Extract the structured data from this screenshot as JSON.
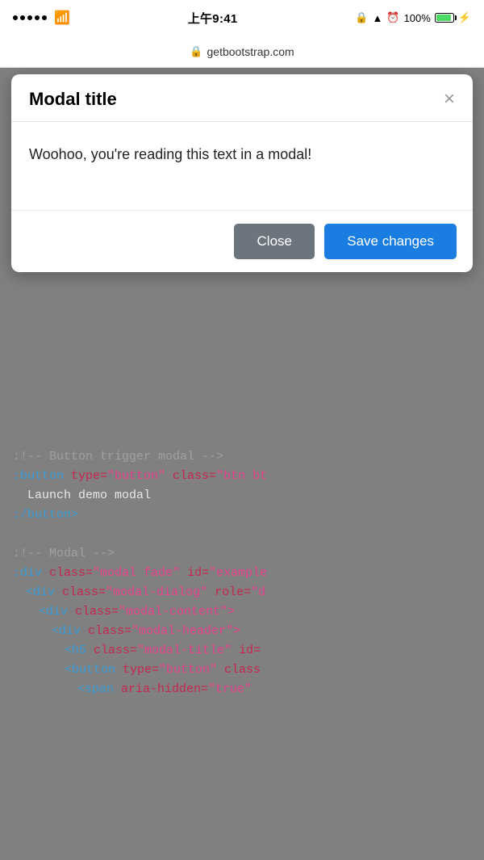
{
  "statusBar": {
    "time": "上午9:41",
    "carrier": "signal",
    "wifi": true,
    "battery": "100%",
    "url": "getbootstrap.com"
  },
  "modal": {
    "title": "Modal title",
    "body": "Woohoo, you're reading this text in a modal!",
    "closeButton": "Close",
    "saveButton": "Save changes",
    "closeIcon": "×"
  },
  "code": {
    "lines": [
      {
        "type": "comment",
        "text": ":!-- Button trigger modal -->"
      },
      {
        "type": "mixed",
        "parts": [
          {
            "t": "tag",
            "v": ":button "
          },
          {
            "t": "attr",
            "v": "type="
          },
          {
            "t": "string",
            "v": "\"button\" "
          },
          {
            "t": "attr",
            "v": "class="
          },
          {
            "t": "string",
            "v": "\"btn bt"
          }
        ]
      },
      {
        "type": "text",
        "text": "  Launch demo modal"
      },
      {
        "type": "tag",
        "text": ":/button>"
      },
      {
        "type": "blank"
      },
      {
        "type": "comment",
        "text": ":!-- Modal -->"
      },
      {
        "type": "mixed",
        "parts": [
          {
            "t": "tag",
            "v": ":div "
          },
          {
            "t": "attr",
            "v": "class="
          },
          {
            "t": "string",
            "v": "\"modal fade\" "
          },
          {
            "t": "attr",
            "v": "id="
          },
          {
            "t": "string",
            "v": "\"example"
          }
        ]
      },
      {
        "type": "mixed",
        "indent": 1,
        "parts": [
          {
            "t": "tag",
            "v": "<div "
          },
          {
            "t": "attr",
            "v": "class="
          },
          {
            "t": "string",
            "v": "\"modal-dialog\" "
          },
          {
            "t": "attr",
            "v": "role="
          },
          {
            "t": "string",
            "v": "\"d"
          }
        ]
      },
      {
        "type": "mixed",
        "indent": 2,
        "parts": [
          {
            "t": "tag",
            "v": "<div "
          },
          {
            "t": "attr",
            "v": "class="
          },
          {
            "t": "string",
            "v": "\"modal-content\">"
          }
        ]
      },
      {
        "type": "mixed",
        "indent": 3,
        "parts": [
          {
            "t": "tag",
            "v": "<div "
          },
          {
            "t": "attr",
            "v": "class="
          },
          {
            "t": "string",
            "v": "\"modal-header\">"
          }
        ]
      },
      {
        "type": "mixed",
        "indent": 4,
        "parts": [
          {
            "t": "tag",
            "v": "<h5 "
          },
          {
            "t": "attr",
            "v": "class="
          },
          {
            "t": "string",
            "v": "\"modal-title\" "
          },
          {
            "t": "attr",
            "v": "id="
          }
        ]
      },
      {
        "type": "mixed",
        "indent": 4,
        "parts": [
          {
            "t": "tag",
            "v": "<button "
          },
          {
            "t": "attr",
            "v": "type="
          },
          {
            "t": "string",
            "v": "\"button\" "
          },
          {
            "t": "attr",
            "v": "class"
          }
        ]
      },
      {
        "type": "mixed",
        "indent": 5,
        "parts": [
          {
            "t": "tag",
            "v": "<span "
          },
          {
            "t": "attr",
            "v": "aria-hidden="
          },
          {
            "t": "string",
            "v": "\"true\""
          }
        ]
      }
    ]
  }
}
